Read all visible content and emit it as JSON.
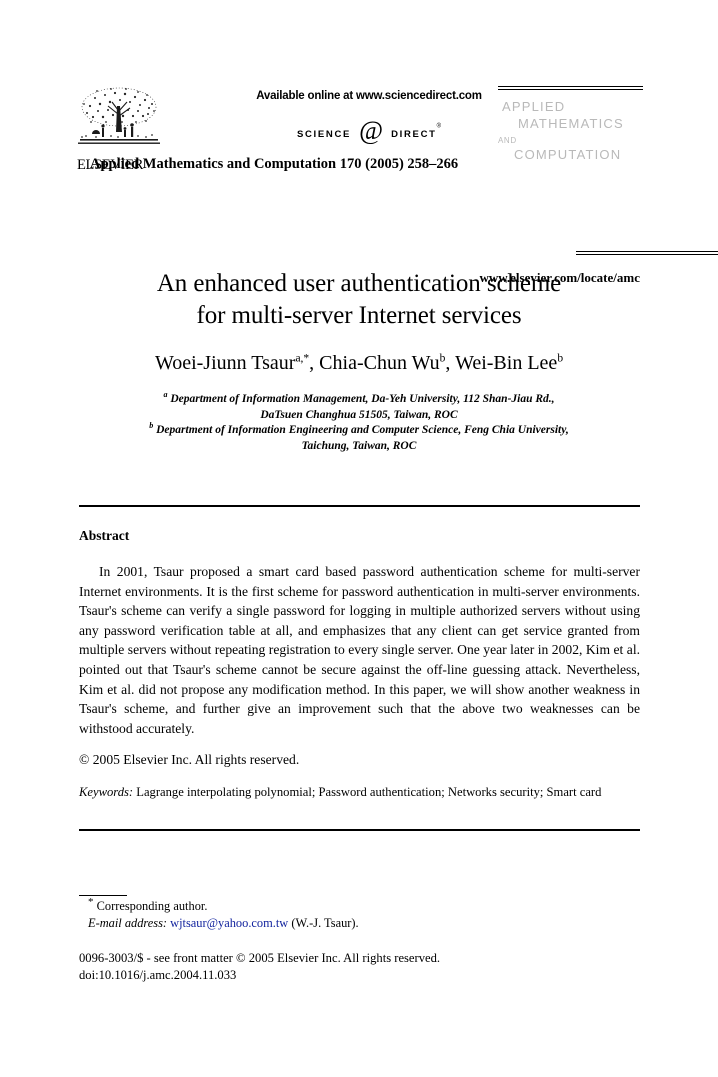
{
  "masthead": {
    "publisher_name": "ELSEVIER",
    "publisher_logo_icon": "elsevier-tree-logo",
    "available_online": "Available online at www.sciencedirect.com",
    "sciencedirect_science": "SCIENCE",
    "sciencedirect_at_icon": "at-sign-icon",
    "sciencedirect_direct": "DIRECT",
    "sciencedirect_registered": "®",
    "journal_mark": {
      "line1": "APPLIED",
      "line2": "MATHEMATICS",
      "line3": "AND",
      "line4": "COMPUTATION",
      "color": "#b9b9b9"
    },
    "journal_citation": "Applied Mathematics and Computation 170 (2005) 258–266",
    "locate_url": "www.elsevier.com/locate/amc"
  },
  "article": {
    "title_line1": "An enhanced user authentication scheme",
    "title_line2": "for multi-server Internet services",
    "authors": [
      {
        "name": "Woei-Jiunn Tsaur",
        "marks": "a,*"
      },
      {
        "name": "Chia-Chun Wu",
        "marks": "b"
      },
      {
        "name": "Wei-Bin Lee",
        "marks": "b"
      }
    ],
    "authors_separator": ", ",
    "affiliations": [
      {
        "mark": "a",
        "line1": "Department of Information Management, Da-Yeh University, 112 Shan-Jiau Rd.,",
        "line2": "DaTsuen Changhua 51505, Taiwan, ROC"
      },
      {
        "mark": "b",
        "line1": "Department of Information Engineering and Computer Science, Feng Chia University,",
        "line2": "Taichung, Taiwan, ROC"
      }
    ]
  },
  "abstract": {
    "heading": "Abstract",
    "body": "In 2001, Tsaur proposed a smart card based password authentication scheme for multi-server Internet environments. It is the first scheme for password authentication in multi-server environments. Tsaur's scheme can verify a single password for logging in multiple authorized servers without using any password verification table at all, and emphasizes that any client can get service granted from multiple servers without repeating registration to every single server. One year later in 2002, Kim et al. pointed out that Tsaur's scheme cannot be secure against the off-line guessing attack. Nevertheless, Kim et al. did not propose any modification method. In this paper, we will show another weakness in Tsaur's scheme, and further give an improvement such that the above two weaknesses can be withstood accurately.",
    "copyright": "© 2005 Elsevier Inc. All rights reserved.",
    "keywords_label": "Keywords:",
    "keywords_text": "Lagrange interpolating polynomial; Password authentication; Networks security; Smart card"
  },
  "footnotes": {
    "corresponding_mark": "*",
    "corresponding_text": "Corresponding author.",
    "email_label": "E-mail address:",
    "email_address": "wjtsaur@yahoo.com.tw",
    "email_owner": "(W.-J. Tsaur).",
    "email_color": "#12239e"
  },
  "imprint": {
    "issn_line": "0096-3003/$ - see front matter © 2005 Elsevier Inc. All rights reserved.",
    "doi_line": "doi:10.1016/j.amc.2004.11.033"
  }
}
